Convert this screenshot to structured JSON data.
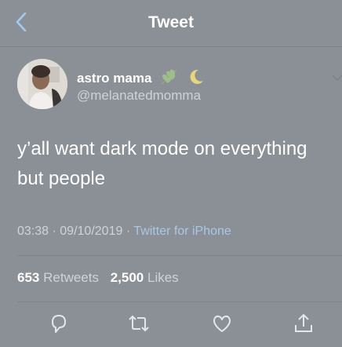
{
  "header": {
    "title": "Tweet",
    "back_icon": "chevron-left-icon"
  },
  "author": {
    "name": "astro mama",
    "name_emoji_icons": [
      "herb-icon",
      "crescent-moon-icon"
    ],
    "handle": "@melanatedmomma"
  },
  "tweet": {
    "text": "y’all want dark mode on everything but people",
    "time": "03:38",
    "separator": "·",
    "date": "09/10/2019",
    "source": "Twitter for iPhone"
  },
  "stats": {
    "retweets_count": "653",
    "retweets_label": "Retweets",
    "likes_count": "2,500",
    "likes_label": "Likes"
  },
  "actions": [
    "reply-icon",
    "retweet-icon",
    "like-icon",
    "share-icon"
  ],
  "colors": {
    "background": "#8b8f96",
    "accent_link": "#a8c8e6",
    "back_icon": "#9ecbef"
  }
}
